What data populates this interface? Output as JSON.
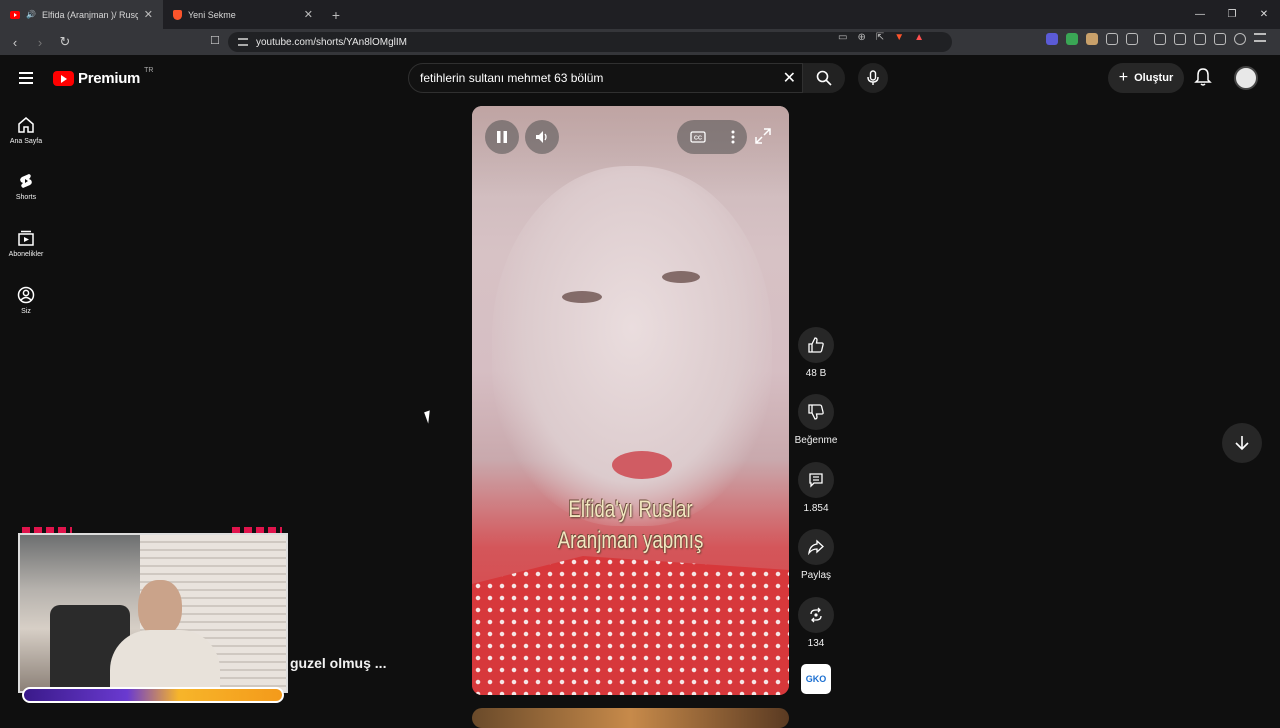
{
  "browser": {
    "tabs": [
      {
        "title": "Elfida (Aranjman )/ Rusça co",
        "active": true
      },
      {
        "title": "Yeni Sekme",
        "active": false
      }
    ],
    "new_tab": "+",
    "url": "youtube.com/shorts/YAn8lOMglIM",
    "window_controls": {
      "minimize": "—",
      "maximize": "❐",
      "close": "✕"
    }
  },
  "header": {
    "logo_text": "Premium",
    "country_code": "TR",
    "search_value": "fetihlerin sultanı mehmet 63 bölüm",
    "create_label": "Oluştur"
  },
  "sidebar": {
    "items": [
      {
        "label": "Ana Sayfa",
        "icon": "home-icon"
      },
      {
        "label": "Shorts",
        "icon": "shorts-icon"
      },
      {
        "label": "Abonelikler",
        "icon": "subscriptions-icon"
      },
      {
        "label": "Siz",
        "icon": "you-icon"
      }
    ]
  },
  "video": {
    "caption_line1": "Elfida'yı Ruslar",
    "caption_line2": "Aranjman yapmış"
  },
  "actions": {
    "like_count": "48 B",
    "dislike_label": "Beğenme",
    "comment_count": "1.854",
    "share_label": "Paylaş",
    "remix_count": "134",
    "channel_badge": "GKO"
  },
  "overlay": {
    "text": "guzel olmuş ..."
  },
  "colors": {
    "background": "#0f0f0f",
    "brand_red": "#ff0000",
    "button_bg": "#272727"
  }
}
